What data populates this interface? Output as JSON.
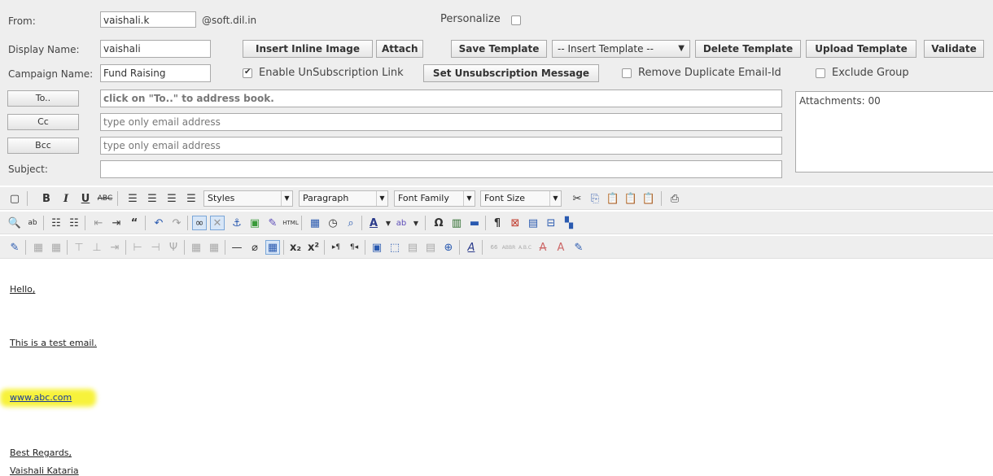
{
  "form": {
    "from_label": "From:",
    "from_value": "vaishali.k",
    "domain": "@soft.dil.in",
    "personalize_label": "Personalize",
    "display_name_label": "Display Name:",
    "display_name_value": "vaishali",
    "insert_image_label": "Insert Inline Image",
    "attach_label": "Attach",
    "save_template_label": "Save Template",
    "insert_template_label": "-- Insert Template --",
    "delete_template_label": "Delete Template",
    "upload_template_label": "Upload Template",
    "validate_label": "Validate",
    "campaign_label": "Campaign Name:",
    "campaign_value": "Fund Raising",
    "unsub_label": "Enable UnSubscription Link",
    "unsub_checked": true,
    "set_unsub_label": "Set Unsubscription Message",
    "remove_dup_label": "Remove Duplicate Email-Id",
    "exclude_group_label": "Exclude Group",
    "to_button": "To..",
    "to_hint": "click on \"To..\" to address book.",
    "cc_button": "Cc",
    "cc_placeholder": "type only email address",
    "bcc_button": "Bcc",
    "bcc_placeholder": "type only email address",
    "subject_label": "Subject:",
    "subject_value": "",
    "attachments_label": "Attachments: 00"
  },
  "toolbar": {
    "styles_label": "Styles",
    "paragraph_label": "Paragraph",
    "font_family_label": "Font Family",
    "font_size_label": "Font Size"
  },
  "body": {
    "line1": "Hello,",
    "line2": "This is a test email.",
    "line3": "www.abc.com",
    "line4": "Best Regards,",
    "line5": "Vaishali Kataria",
    "highlight_color": "#f7f23b"
  }
}
